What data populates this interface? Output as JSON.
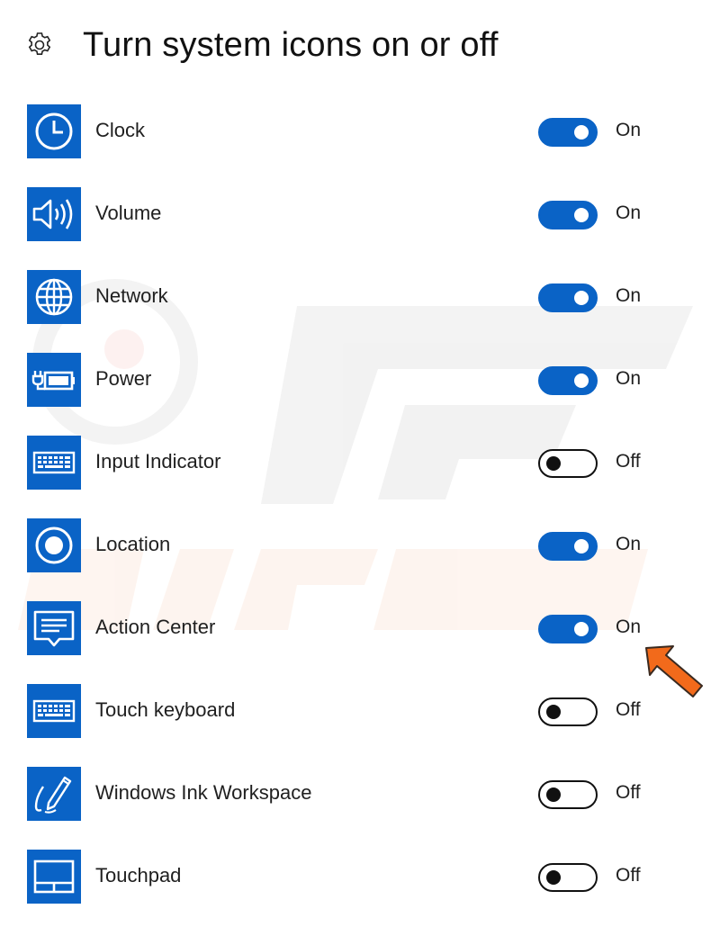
{
  "header": {
    "title": "Turn system icons on or off",
    "icon": "gear-icon"
  },
  "items": [
    {
      "label": "Clock",
      "state": "On",
      "on": true,
      "icon": "clock-icon"
    },
    {
      "label": "Volume",
      "state": "On",
      "on": true,
      "icon": "volume-icon"
    },
    {
      "label": "Network",
      "state": "On",
      "on": true,
      "icon": "network-globe-icon"
    },
    {
      "label": "Power",
      "state": "On",
      "on": true,
      "icon": "power-battery-icon"
    },
    {
      "label": "Input Indicator",
      "state": "Off",
      "on": false,
      "icon": "keyboard-icon"
    },
    {
      "label": "Location",
      "state": "On",
      "on": true,
      "icon": "location-icon"
    },
    {
      "label": "Action Center",
      "state": "On",
      "on": true,
      "icon": "action-center-icon"
    },
    {
      "label": "Touch keyboard",
      "state": "Off",
      "on": false,
      "icon": "keyboard-icon"
    },
    {
      "label": "Windows Ink Workspace",
      "state": "Off",
      "on": false,
      "icon": "pen-icon"
    },
    {
      "label": "Touchpad",
      "state": "Off",
      "on": false,
      "icon": "touchpad-icon"
    }
  ],
  "colors": {
    "accent": "#0a63c6",
    "arrow": "#f26a1b"
  }
}
